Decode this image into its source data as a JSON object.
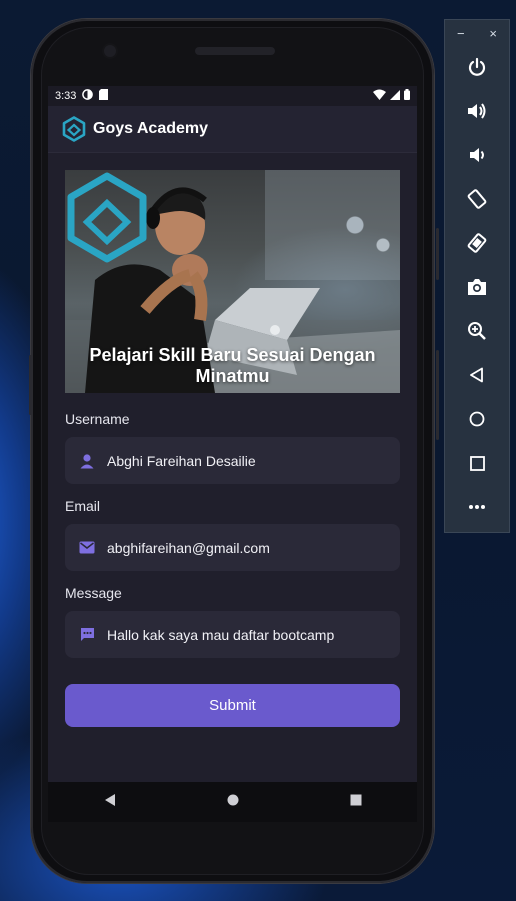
{
  "status_bar": {
    "time": "3:33",
    "left_icons": [
      "data-saver-icon",
      "sd-card-icon"
    ],
    "right_icons": [
      "wifi-icon",
      "signal-icon",
      "battery-icon"
    ]
  },
  "app_bar": {
    "title": "Goys Academy",
    "logo_icon": "hexagon-logo-icon"
  },
  "hero": {
    "caption": "Pelajari Skill Baru Sesuai Dengan Minatmu"
  },
  "form": {
    "username": {
      "label": "Username",
      "value": "Abghi Fareihan Desailie",
      "icon": "person-icon"
    },
    "email": {
      "label": "Email",
      "value": "abghifareihan@gmail.com",
      "icon": "mail-icon"
    },
    "message": {
      "label": "Message",
      "value": "Hallo kak saya mau daftar bootcamp",
      "icon": "chat-icon"
    },
    "submit_label": "Submit"
  },
  "nav_bar": {
    "buttons": [
      "back-icon",
      "home-icon",
      "recents-icon"
    ]
  },
  "emulator_toolbar": {
    "minimize": "−",
    "close": "×",
    "buttons": [
      "power-icon",
      "volume-up-icon",
      "volume-down-icon",
      "rotate-left-icon",
      "rotate-right-icon",
      "camera-icon",
      "zoom-icon",
      "back-icon",
      "home-icon",
      "overview-icon",
      "more-icon"
    ]
  },
  "colors": {
    "accent": "#6a5acd",
    "logo": "#2aa5c4",
    "screen_bg": "#201f2c",
    "field_bg": "#2a2938"
  }
}
